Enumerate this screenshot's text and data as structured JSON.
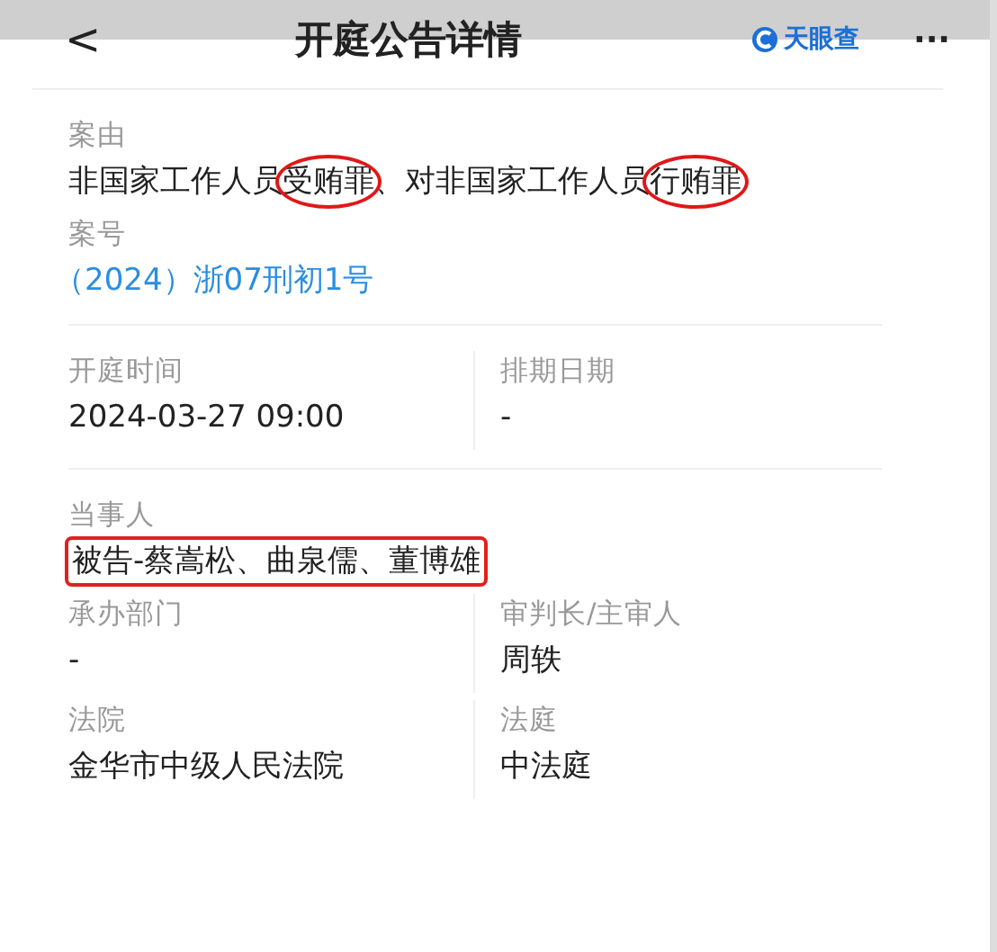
{
  "header": {
    "back": "<",
    "title": "开庭公告详情",
    "brand": "天眼查",
    "more": "···"
  },
  "sections": [
    {
      "fields": [
        {
          "label": "案由",
          "segments": [
            {
              "text": "非国家工作人员",
              "circled": false
            },
            {
              "text": "受贿罪",
              "circled": true
            },
            {
              "text": "、对非国家工作人员",
              "circled": false
            },
            {
              "text": "行贿罪",
              "circled": true
            }
          ]
        },
        {
          "label": "案号",
          "value": "（2024）浙07刑初1号",
          "link": true
        }
      ]
    },
    {
      "pairs": [
        [
          {
            "label": "开庭时间",
            "value": "2024-03-27 09:00"
          },
          {
            "label": "排期日期",
            "value": "-"
          }
        ]
      ]
    },
    {
      "fields": [
        {
          "label": "当事人",
          "value": "被告-蔡嵩松、曲泉儒、董博雄",
          "highlighted": true
        }
      ],
      "pairs": [
        [
          {
            "label": "承办部门",
            "value": "-"
          },
          {
            "label": "审判长/主审人",
            "value": "周轶"
          }
        ],
        [
          {
            "label": "法院",
            "value": "金华市中级人民法院"
          },
          {
            "label": "法庭",
            "value": "中法庭"
          }
        ]
      ]
    }
  ]
}
